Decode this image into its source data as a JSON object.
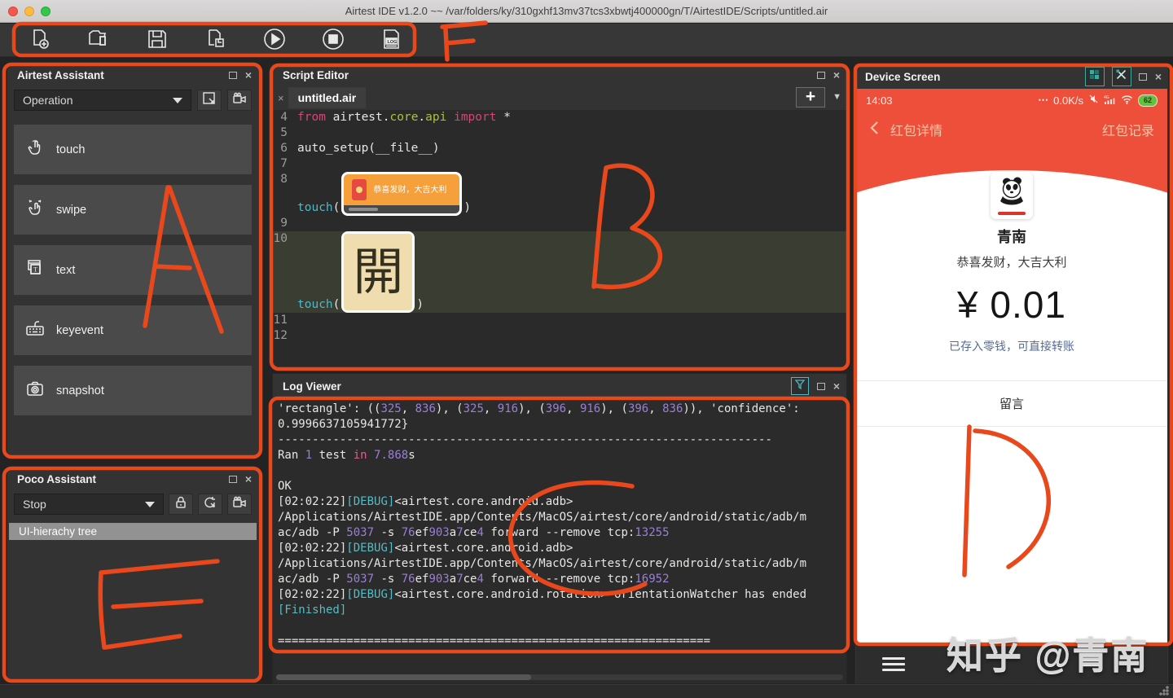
{
  "window": {
    "title": "Airtest IDE v1.2.0 ~~ /var/folders/ky/310gxhf13mv37tcs3xbwtj400000gn/T/AirtestIDE/Scripts/untitled.air"
  },
  "toolbar": {
    "icons": [
      "new-script-icon",
      "open-script-icon",
      "save-icon",
      "save-as-icon",
      "run-icon",
      "stop-icon",
      "log-icon"
    ]
  },
  "airtest_assistant": {
    "title": "Airtest Assistant",
    "mode_dropdown": "Operation",
    "header_icons": [
      "snip-icon",
      "record-icon"
    ],
    "items": [
      {
        "icon": "touch-icon",
        "label": "touch"
      },
      {
        "icon": "swipe-icon",
        "label": "swipe"
      },
      {
        "icon": "text-icon",
        "label": "text"
      },
      {
        "icon": "keyevent-icon",
        "label": "keyevent"
      },
      {
        "icon": "snapshot-icon",
        "label": "snapshot"
      }
    ]
  },
  "poco_assistant": {
    "title": "Poco Assistant",
    "mode_dropdown": "Stop",
    "header_icons": [
      "lock-icon",
      "inspect-refresh-icon",
      "record-icon"
    ],
    "tree_header": "UI-hierachy tree"
  },
  "script_editor": {
    "title": "Script Editor",
    "tab": "untitled.air",
    "tab_close": "×",
    "add_tab": "+",
    "images": {
      "redpacket_text": "恭喜发财，大吉大利",
      "kai_char": "開"
    },
    "code": {
      "lines": [
        {
          "no": 4,
          "segs": [
            {
              "t": "from ",
              "c": "kw"
            },
            {
              "t": "airtest",
              "c": "w"
            },
            {
              "t": ".",
              "c": "w"
            },
            {
              "t": "core",
              "c": "mod"
            },
            {
              "t": ".",
              "c": "w"
            },
            {
              "t": "api",
              "c": "mod"
            },
            {
              "t": " ",
              "c": "w"
            },
            {
              "t": "import",
              "c": "kw"
            },
            {
              "t": " *",
              "c": "w"
            }
          ]
        },
        {
          "no": 5,
          "segs": []
        },
        {
          "no": 6,
          "segs": [
            {
              "t": "auto_setup(__file__)",
              "c": "w"
            }
          ]
        },
        {
          "no": 7,
          "segs": []
        },
        {
          "no": 8,
          "img": "redpacket",
          "fn": "touch",
          "open": "(",
          "close": ")"
        },
        {
          "no": 9,
          "segs": []
        },
        {
          "no": 10,
          "img": "kai",
          "fn": "touch",
          "open": "(",
          "close": ")",
          "highlight": true
        },
        {
          "no": 11,
          "segs": []
        },
        {
          "no": 12,
          "segs": []
        }
      ]
    }
  },
  "log_viewer": {
    "title": "Log Viewer",
    "lines": [
      [
        {
          "t": "'rectangle': ((",
          "c": "w"
        },
        {
          "t": "325",
          "c": "n"
        },
        {
          "t": ", ",
          "c": "w"
        },
        {
          "t": "836",
          "c": "n"
        },
        {
          "t": "), (",
          "c": "w"
        },
        {
          "t": "325",
          "c": "n"
        },
        {
          "t": ", ",
          "c": "w"
        },
        {
          "t": "916",
          "c": "n"
        },
        {
          "t": "), (",
          "c": "w"
        },
        {
          "t": "396",
          "c": "n"
        },
        {
          "t": ", ",
          "c": "w"
        },
        {
          "t": "916",
          "c": "n"
        },
        {
          "t": "), (",
          "c": "w"
        },
        {
          "t": "396",
          "c": "n"
        },
        {
          "t": ", ",
          "c": "w"
        },
        {
          "t": "836",
          "c": "n"
        },
        {
          "t": ")), 'confidence':",
          "c": "w"
        }
      ],
      [
        {
          "t": "0.9996637105941772}",
          "c": "w"
        }
      ],
      [
        {
          "t": "------------------------------------------------------------------------",
          "c": "w"
        }
      ],
      [
        {
          "t": "Ran ",
          "c": "w"
        },
        {
          "t": "1",
          "c": "n"
        },
        {
          "t": " test ",
          "c": "w"
        },
        {
          "t": "in",
          "c": "p"
        },
        {
          "t": " ",
          "c": "w"
        },
        {
          "t": "7.868",
          "c": "n"
        },
        {
          "t": "s",
          "c": "w"
        }
      ],
      [],
      [
        {
          "t": "OK",
          "c": "w"
        }
      ],
      [
        {
          "t": "[02:02:22]",
          "c": "w"
        },
        {
          "t": "[DEBUG]",
          "c": "c"
        },
        {
          "t": "<airtest.core.android.adb>",
          "c": "w"
        }
      ],
      [
        {
          "t": "/Applications/AirtestIDE.app/Contents/MacOS/airtest/core/android/static/adb/m",
          "c": "w"
        }
      ],
      [
        {
          "t": "ac/adb -P ",
          "c": "w"
        },
        {
          "t": "5037",
          "c": "n"
        },
        {
          "t": " -s ",
          "c": "w"
        },
        {
          "t": "76",
          "c": "n"
        },
        {
          "t": "ef",
          "c": "w"
        },
        {
          "t": "903",
          "c": "n"
        },
        {
          "t": "a",
          "c": "w"
        },
        {
          "t": "7",
          "c": "n"
        },
        {
          "t": "ce",
          "c": "w"
        },
        {
          "t": "4",
          "c": "n"
        },
        {
          "t": " forward --remove tcp:",
          "c": "w"
        },
        {
          "t": "13255",
          "c": "n"
        }
      ],
      [
        {
          "t": "[02:02:22]",
          "c": "w"
        },
        {
          "t": "[DEBUG]",
          "c": "c"
        },
        {
          "t": "<airtest.core.android.adb>",
          "c": "w"
        }
      ],
      [
        {
          "t": "/Applications/AirtestIDE.app/Contents/MacOS/airtest/core/android/static/adb/m",
          "c": "w"
        }
      ],
      [
        {
          "t": "ac/adb -P ",
          "c": "w"
        },
        {
          "t": "5037",
          "c": "n"
        },
        {
          "t": " -s ",
          "c": "w"
        },
        {
          "t": "76",
          "c": "n"
        },
        {
          "t": "ef",
          "c": "w"
        },
        {
          "t": "903",
          "c": "n"
        },
        {
          "t": "a",
          "c": "w"
        },
        {
          "t": "7",
          "c": "n"
        },
        {
          "t": "ce",
          "c": "w"
        },
        {
          "t": "4",
          "c": "n"
        },
        {
          "t": " forward --remove tcp:",
          "c": "w"
        },
        {
          "t": "16952",
          "c": "n"
        }
      ],
      [
        {
          "t": "[02:02:22]",
          "c": "w"
        },
        {
          "t": "[DEBUG]",
          "c": "c"
        },
        {
          "t": "<airtest.core.android.rotation> orientationWatcher has ended",
          "c": "w"
        }
      ],
      [
        {
          "t": "[Finished]",
          "c": "c"
        }
      ],
      [],
      [
        {
          "t": "===============================================================",
          "c": "w"
        }
      ]
    ]
  },
  "device_screen": {
    "title": "Device Screen",
    "header_icons": [
      "layout-icon",
      "tools-icon"
    ],
    "phone": {
      "time": "14:03",
      "more_dots": "⋯",
      "net_speed": "0.0K/s",
      "battery": "62",
      "nav_back": "❮",
      "nav_title": "红包详情",
      "nav_action": "红包记录",
      "sender": "青南",
      "greeting": "恭喜发财，大吉大利",
      "amount": "¥ 0.01",
      "amount_note": "已存入零钱，可直接转账",
      "message_label": "留言"
    }
  },
  "annotations": {
    "color": "#e8481c",
    "letters": [
      "A",
      "B",
      "C",
      "D",
      "E",
      "F"
    ]
  },
  "watermark": "知乎 @青南"
}
